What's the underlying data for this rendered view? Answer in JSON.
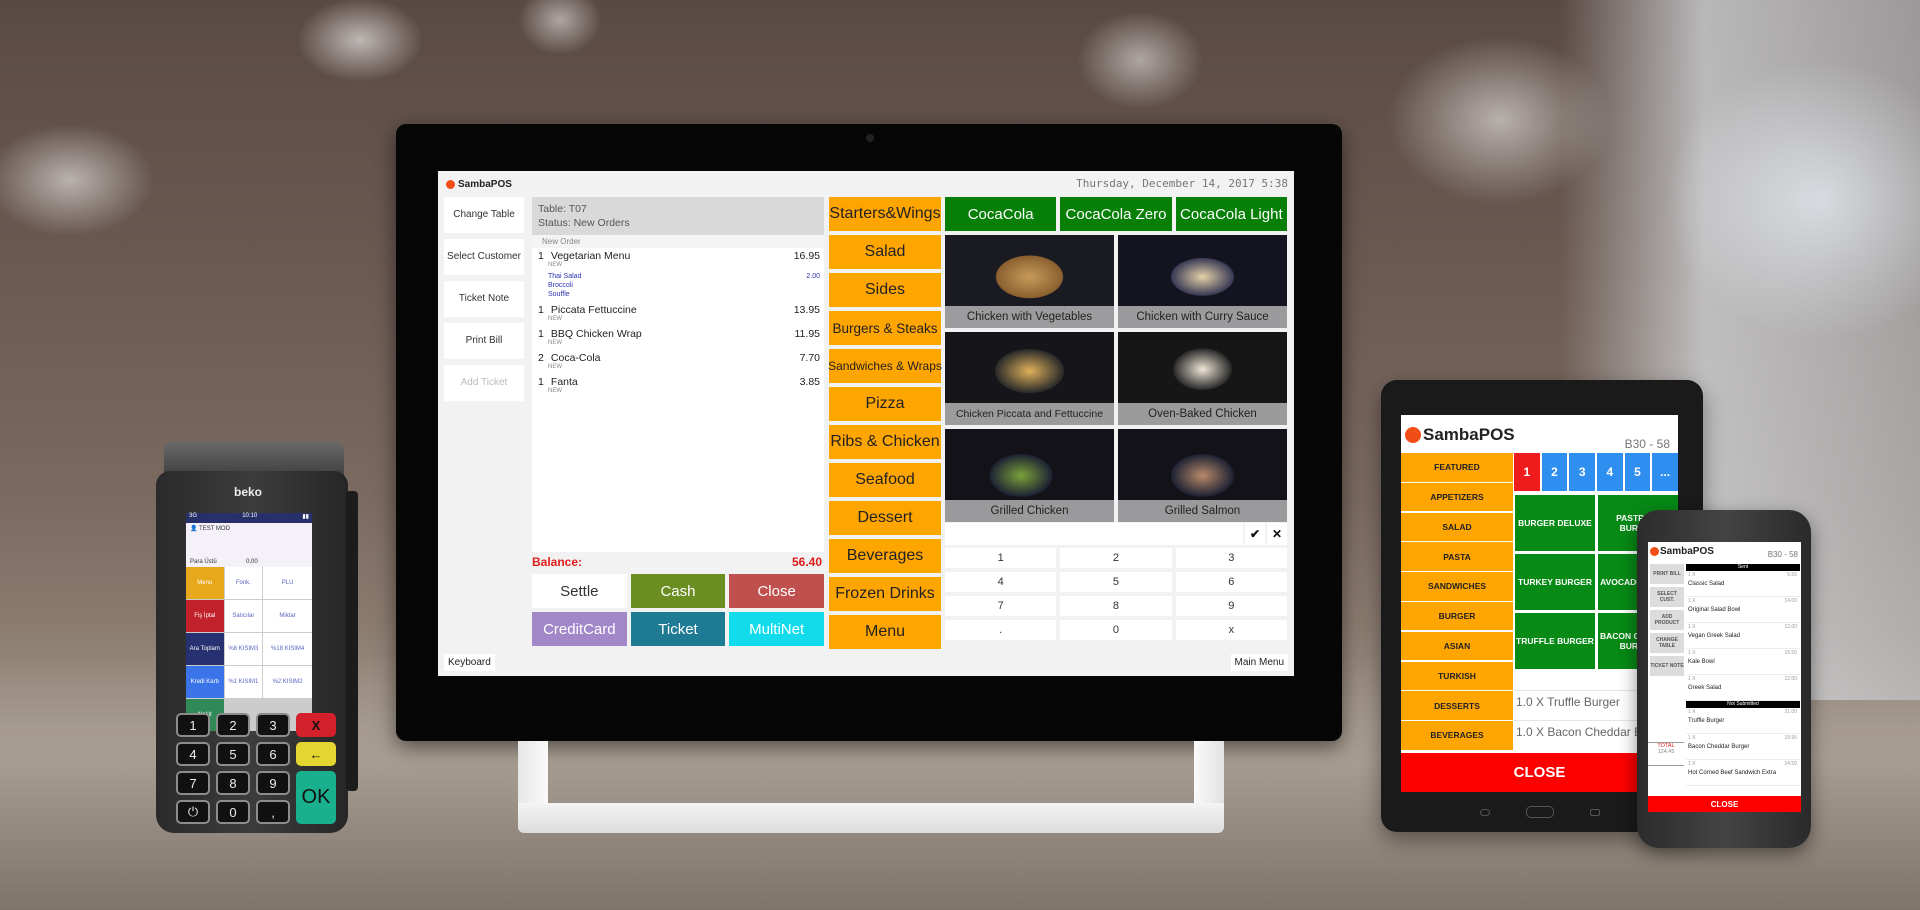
{
  "monitor": {
    "brand": "SambaPOS",
    "datetime": "Thursday, December 14, 2017 5:38",
    "left_buttons": [
      {
        "label": "Change Table",
        "enabled": true
      },
      {
        "label": "Select Customer",
        "enabled": true
      },
      {
        "label": "Ticket Note",
        "enabled": true
      },
      {
        "label": "Print Bill",
        "enabled": true
      },
      {
        "label": "Add Ticket",
        "enabled": false
      }
    ],
    "ticket": {
      "table": "Table: T07",
      "status": "Status: New Orders",
      "section": "New Order",
      "orders": [
        {
          "qty": "1",
          "name": "Vegetarian Menu",
          "price": "16.95",
          "tag": "NEW",
          "modifiers": [
            "Thai Salad",
            "Broccoli",
            "Souffle"
          ],
          "modifier_price": "2.00"
        },
        {
          "qty": "1",
          "name": "Piccata Fettuccine",
          "price": "13.95",
          "tag": "NEW"
        },
        {
          "qty": "1",
          "name": "BBQ Chicken Wrap",
          "price": "11.95",
          "tag": "NEW"
        },
        {
          "qty": "2",
          "name": "Coca-Cola",
          "price": "7.70",
          "tag": "NEW"
        },
        {
          "qty": "1",
          "name": "Fanta",
          "price": "3.85",
          "tag": "NEW"
        }
      ],
      "balance_label": "Balance:",
      "balance_value": "56.40"
    },
    "payment_buttons": [
      {
        "label": "Settle",
        "color": "#ffffff",
        "text_color": "#333333"
      },
      {
        "label": "Cash",
        "color": "#6b8e23",
        "text_color": "#ffffff"
      },
      {
        "label": "Close",
        "color": "#c0504d",
        "text_color": "#ffffff"
      },
      {
        "label": "CreditCard",
        "color": "#a288c8",
        "text_color": "#ffffff"
      },
      {
        "label": "Ticket",
        "color": "#1f7a94",
        "text_color": "#ffffff"
      },
      {
        "label": "MultiNet",
        "color": "#12dcec",
        "text_color": "#ffffff"
      }
    ],
    "categories": [
      "Starters&Wings",
      "Salad",
      "Sides",
      "Burgers & Steaks",
      "Sandwiches & Wraps",
      "Pizza",
      "Ribs & Chicken",
      "Seafood",
      "Dessert",
      "Beverages",
      "Frozen Drinks",
      "Menu"
    ],
    "drinks": [
      "CocaCola",
      "CocaCola Zero",
      "CocaCola Light"
    ],
    "foods": [
      "Chicken with Vegetables",
      "Chicken with Curry Sauce",
      "Chicken Piccata and Fettuccine",
      "Oven-Baked Chicken",
      "Grilled Chicken",
      "Grilled Salmon"
    ],
    "numpad_input": "",
    "confirm_icon": "check-icon",
    "clear_icon": "close-icon",
    "numpad": [
      "1",
      "2",
      "3",
      "4",
      "5",
      "6",
      "7",
      "8",
      "9",
      ".",
      "0",
      "x"
    ],
    "keyboard_label": "Keyboard",
    "main_menu_label": "Main Menu"
  },
  "pos_terminal": {
    "brand": "beko",
    "signal": "3G",
    "time": "10:10",
    "mode": "TEST MOD",
    "change_label": "Para Üstü",
    "change_value": "0,00",
    "tiles": [
      "Menu",
      "Fonk.",
      "PLU",
      "Fiş İptal",
      "Satıcılar",
      "Miktar",
      "Ara Toplam",
      "%8 KISIM3",
      "%18 KISIM4",
      "Kredi Kartı",
      "%1 KISIM1",
      "%2 KISIM2",
      "Nakit"
    ],
    "keys": [
      "1",
      "2",
      "3",
      "X",
      "4",
      "5",
      "6",
      "←",
      "7",
      "8",
      "9",
      "OK",
      "⏻",
      "0",
      ","
    ]
  },
  "tablet": {
    "brand": "SambaPOS",
    "code": "B30 - 58",
    "categories": [
      "FEATURED",
      "APPETIZERS",
      "SALAD",
      "PASTA",
      "SANDWICHES",
      "BURGER",
      "ASIAN",
      "TURKISH",
      "DESSERTS",
      "BEVERAGES"
    ],
    "pages": [
      "1",
      "2",
      "3",
      "4",
      "5",
      "..."
    ],
    "active_page": "1",
    "products": [
      "BURGER DELUXE",
      "PASTRAMI BURGER",
      "TURKEY BURGER",
      "AVOCADO RANCH",
      "TRUFFLE BURGER",
      "BACON CHEDDAR BURGER"
    ],
    "orders": [
      "1.0 X Truffle Burger",
      "1.0 X Bacon Cheddar Burger"
    ],
    "close_label": "CLOSE"
  },
  "phone": {
    "brand": "SambaPOS",
    "code": "B30 - 58",
    "left_buttons": [
      "PRINT BILL",
      "SELECT CUST.",
      "ADD PRODUCT",
      "CHANGE TABLE",
      "TICKET NOTE"
    ],
    "total_label": "TOTAL",
    "total_value": "124.45",
    "sections": [
      {
        "title": "Sent",
        "items": [
          {
            "qty": "1 X",
            "name": "Classic Salad",
            "price": "5.50"
          },
          {
            "qty": "1 X",
            "name": "Original Salad Bowl",
            "price": "14.00"
          },
          {
            "qty": "1 X",
            "name": "Vegan Greek Salad",
            "price": "12.00"
          },
          {
            "qty": "1 X",
            "name": "Kale Bowl",
            "price": "15.50"
          },
          {
            "qty": "1 X",
            "name": "Greek Salad",
            "price": "12.00"
          }
        ]
      },
      {
        "title": "Not Submitted",
        "items": [
          {
            "qty": "1 X",
            "name": "Truffle Burger",
            "price": "21.00"
          },
          {
            "qty": "1 X",
            "name": "Bacon Cheddar Burger",
            "price": "19.95"
          },
          {
            "qty": "1 X",
            "name": "Hot Corned Beef Sandwich Extra",
            "price": "24.50"
          }
        ]
      }
    ],
    "close_label": "CLOSE"
  }
}
